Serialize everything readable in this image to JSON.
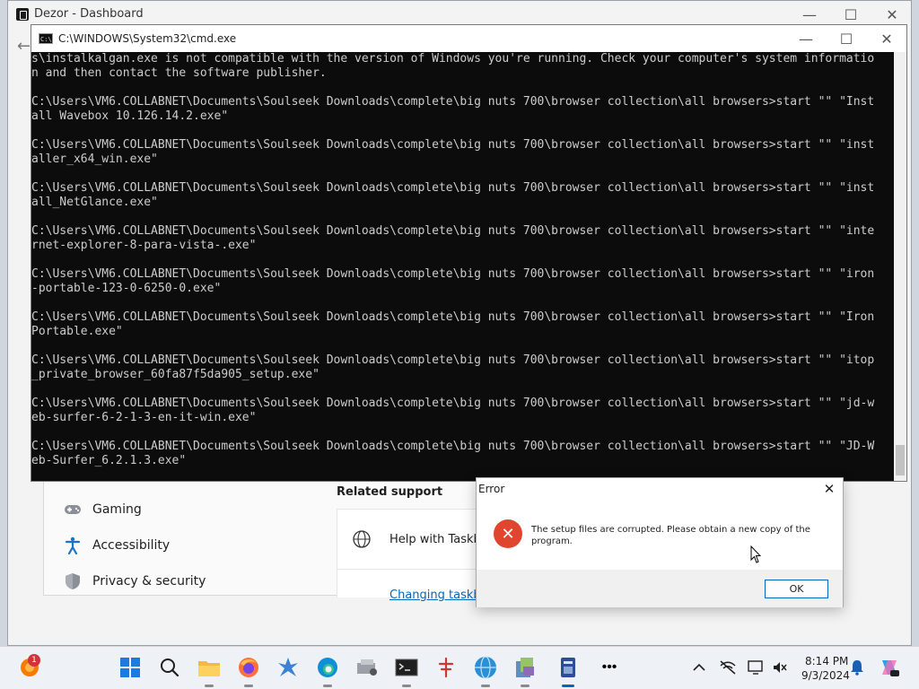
{
  "outer_window": {
    "title": "Dezor - Dashboard"
  },
  "window_controls": {
    "minimize": "—",
    "maximize": "☐",
    "close": "✕"
  },
  "cmd_window": {
    "title": "C:\\WINDOWS\\System32\\cmd.exe",
    "icon_label": "C:\\",
    "lines": [
      "s\\instalkalgan.exe is not compatible with the version of Windows you're running. Check your computer's system informatio",
      "n and then contact the software publisher.",
      "",
      "C:\\Users\\VM6.COLLABNET\\Documents\\Soulseek Downloads\\complete\\big nuts 700\\browser collection\\all browsers>start \"\" \"Inst",
      "all Wavebox 10.126.14.2.exe\"",
      "",
      "C:\\Users\\VM6.COLLABNET\\Documents\\Soulseek Downloads\\complete\\big nuts 700\\browser collection\\all browsers>start \"\" \"inst",
      "aller_x64_win.exe\"",
      "",
      "C:\\Users\\VM6.COLLABNET\\Documents\\Soulseek Downloads\\complete\\big nuts 700\\browser collection\\all browsers>start \"\" \"inst",
      "all_NetGlance.exe\"",
      "",
      "C:\\Users\\VM6.COLLABNET\\Documents\\Soulseek Downloads\\complete\\big nuts 700\\browser collection\\all browsers>start \"\" \"inte",
      "rnet-explorer-8-para-vista-.exe\"",
      "",
      "C:\\Users\\VM6.COLLABNET\\Documents\\Soulseek Downloads\\complete\\big nuts 700\\browser collection\\all browsers>start \"\" \"iron",
      "-portable-123-0-6250-0.exe\"",
      "",
      "C:\\Users\\VM6.COLLABNET\\Documents\\Soulseek Downloads\\complete\\big nuts 700\\browser collection\\all browsers>start \"\" \"Iron",
      "Portable.exe\"",
      "",
      "C:\\Users\\VM6.COLLABNET\\Documents\\Soulseek Downloads\\complete\\big nuts 700\\browser collection\\all browsers>start \"\" \"itop",
      "_private_browser_60fa87f5da905_setup.exe\"",
      "",
      "C:\\Users\\VM6.COLLABNET\\Documents\\Soulseek Downloads\\complete\\big nuts 700\\browser collection\\all browsers>start \"\" \"jd-w",
      "eb-surfer-6-2-1-3-en-it-win.exe\"",
      "",
      "C:\\Users\\VM6.COLLABNET\\Documents\\Soulseek Downloads\\complete\\big nuts 700\\browser collection\\all browsers>start \"\" \"JD-W",
      "eb-Surfer_6.2.1.3.exe\""
    ]
  },
  "settings": {
    "nav": [
      {
        "label": "Gaming",
        "icon": "gamepad-icon"
      },
      {
        "label": "Accessibility",
        "icon": "accessibility-icon"
      },
      {
        "label": "Privacy & security",
        "icon": "shield-icon"
      }
    ],
    "related_title": "Related support",
    "help_item": "Help with Taskb",
    "link": "Changing taskb"
  },
  "error_dialog": {
    "title": "Error",
    "close": "✕",
    "message": "The setup files are corrupted. Please obtain a new copy of the program.",
    "ok_label": "OK",
    "icon": "error-icon"
  },
  "taskbar": {
    "notification_count": "1",
    "time": "8:14 PM",
    "date": "9/3/2024",
    "overflow": "•••",
    "apps": [
      "start-icon",
      "search-icon",
      "file-explorer-icon",
      "firefox-icon",
      "app-icon",
      "edge-icon",
      "app-icon",
      "terminal-icon",
      "app-icon",
      "browser-icon",
      "app-icon",
      "app-icon",
      "more-icon"
    ]
  },
  "colors": {
    "accent": "#0067c0",
    "error": "#e0462e",
    "console_bg": "#0c0c0c",
    "console_text": "#cccccc"
  }
}
